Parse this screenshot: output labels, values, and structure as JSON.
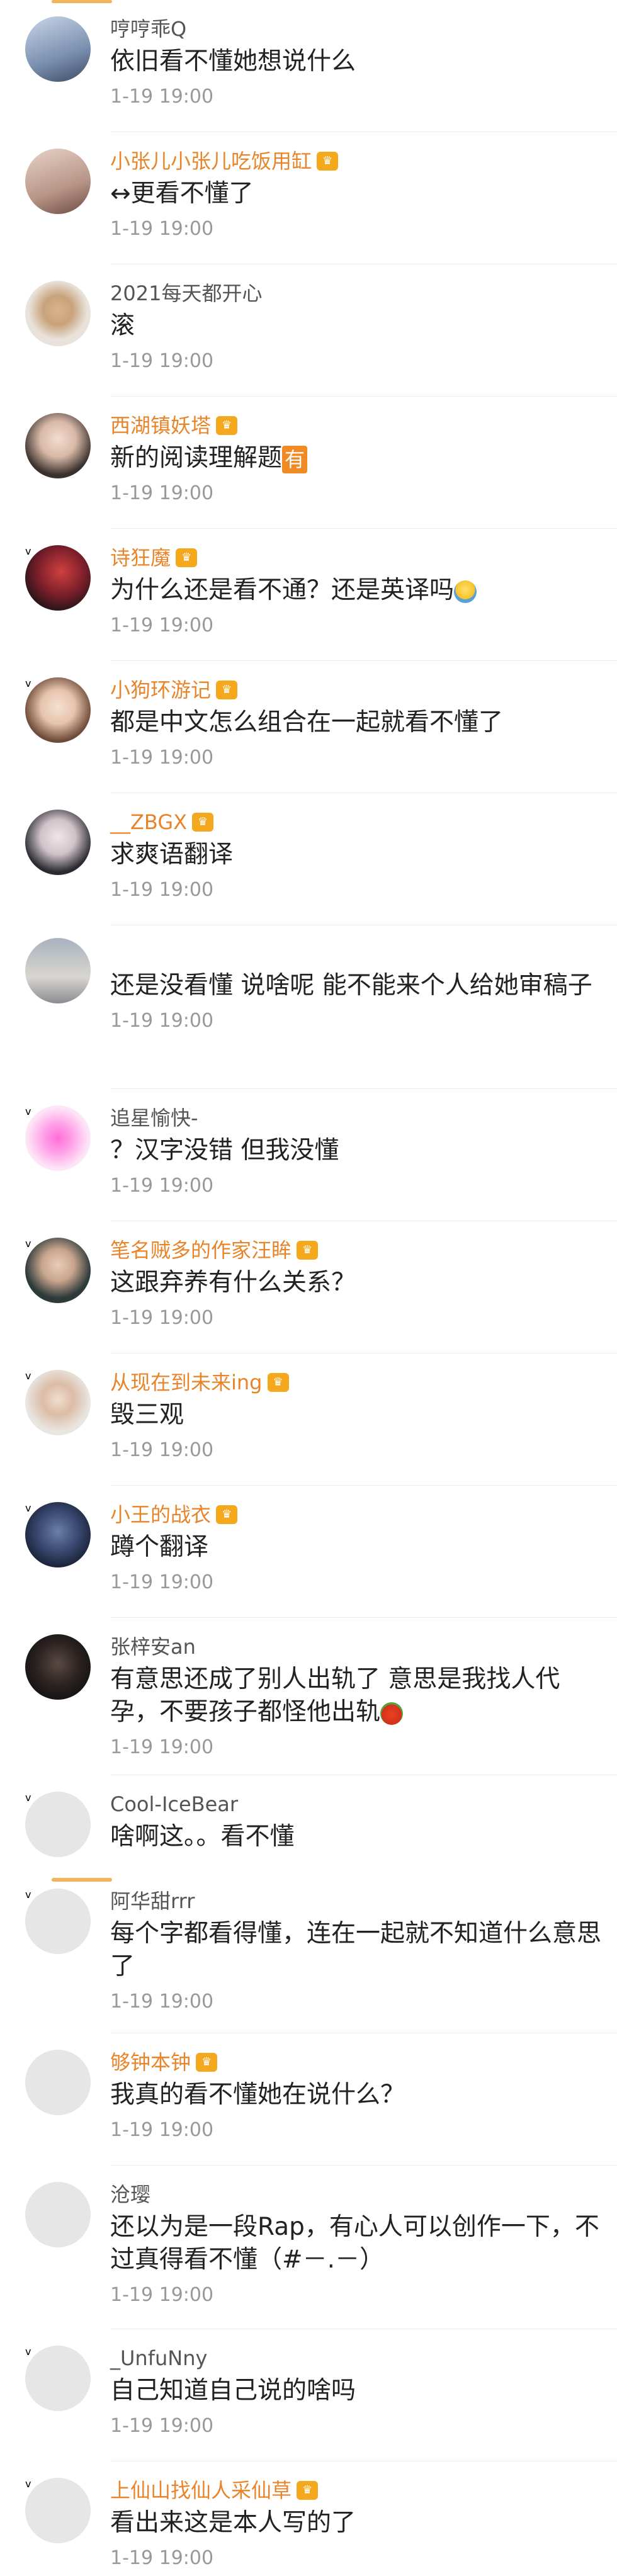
{
  "comments": [
    {
      "username": "哼哼乖Q",
      "text": "依旧看不懂她想说什么",
      "time": "1-19 19:00"
    },
    {
      "username": "小张儿小张儿吃饭用缸",
      "text": "↔更看不懂了",
      "time": "1-19 19:00"
    },
    {
      "username": "2021每天都开心",
      "text": "滚",
      "time": "1-19 19:00"
    },
    {
      "username": "西湖镇妖塔",
      "text": "新的阅读理解题",
      "tag": "有",
      "time": "1-19 19:00"
    },
    {
      "username": "诗狂魔",
      "text": "为什么还是看不通？还是英译吗",
      "time": "1-19 19:00"
    },
    {
      "username": "小狗环游记",
      "text": "都是中文怎么组合在一起就看不懂了",
      "time": "1-19 19:00"
    },
    {
      "username": "__ZBGX",
      "text": "求爽语翻译",
      "time": "1-19 19:00"
    },
    {
      "username": "",
      "text": "还是没看懂 说啥呢 能不能来个人给她审稿子",
      "time": "1-19 19:00"
    },
    {
      "username": "追星愉快-",
      "text": "？汉字没错 但我没懂",
      "time": "1-19 19:00"
    },
    {
      "username": "笔名贼多的作家汪眸",
      "text": "这跟弃养有什么关系？",
      "time": "1-19 19:00"
    },
    {
      "username": "从现在到未来ing",
      "text": "毁三观",
      "time": "1-19 19:00"
    },
    {
      "username": "小王的战衣",
      "text": "蹲个翻译",
      "time": "1-19 19:00"
    },
    {
      "username": "张梓安an",
      "text": "有意思还成了别人出轨了 意思是我找人代孕，不要孩子都怪他出轨",
      "time": "1-19 19:00"
    },
    {
      "username": "Cool-IceBear",
      "text": "啥啊这。。看不懂",
      "time": ""
    },
    {
      "username": "阿华甜rrr",
      "text": "每个字都看得懂，连在一起就不知道什么意思了",
      "time": "1-19 19:00"
    },
    {
      "username": "够钟本钟",
      "text": "我真的看不懂她在说什么？",
      "time": "1-19 19:00"
    },
    {
      "username": "沧璎",
      "text": "还以为是一段Rap，有心人可以创作一下，不过真得看不懂（#－.－）",
      "time": "1-19 19:00"
    },
    {
      "username": "_UnfuNny",
      "text": "自己知道自己说的啥吗",
      "time": "1-19 19:00"
    },
    {
      "username": "上仙山找仙人采仙草",
      "text": "看出来这是本人写的了",
      "time": "1-19 19:00"
    }
  ]
}
